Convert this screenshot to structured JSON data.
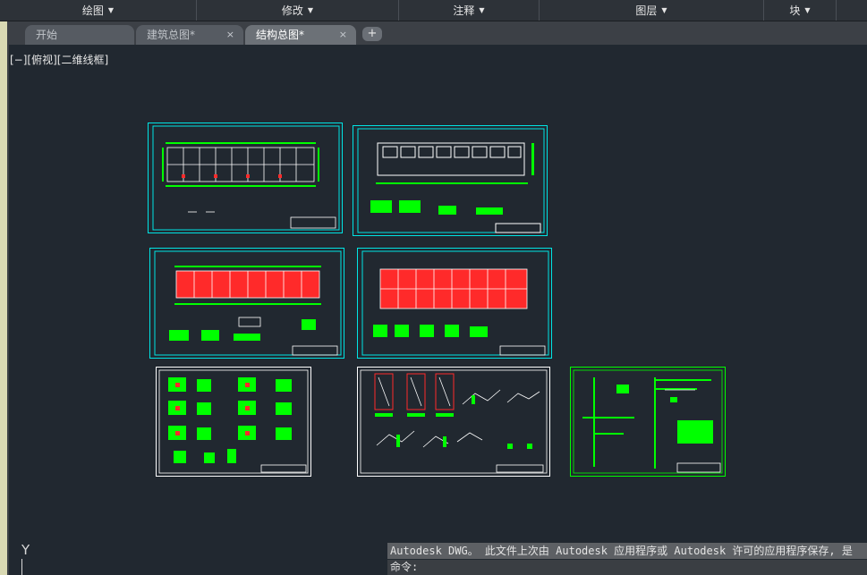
{
  "ribbon": {
    "panels": [
      {
        "label": "绘图"
      },
      {
        "label": "修改"
      },
      {
        "label": "注释"
      },
      {
        "label": "图层"
      },
      {
        "label": "块"
      }
    ]
  },
  "tabs": [
    {
      "label": "开始"
    },
    {
      "label": "建筑总图*"
    },
    {
      "label": "结构总图*"
    }
  ],
  "tab_add": "+",
  "tab_close": "×",
  "view_label": "[−][俯视][二维线框]",
  "ucs_label": "Y",
  "command": {
    "message": "Autodesk DWG。  此文件上次由 Autodesk 应用程序或 Autodesk 许可的应用程序保存, 是",
    "prompt": "命令:"
  },
  "colors": {
    "background": "#212830",
    "frame_cyan": "#00e5e5",
    "frame_white": "#ffffff",
    "frame_green": "#00ff00",
    "drawing_red": "#ff2a2a"
  }
}
